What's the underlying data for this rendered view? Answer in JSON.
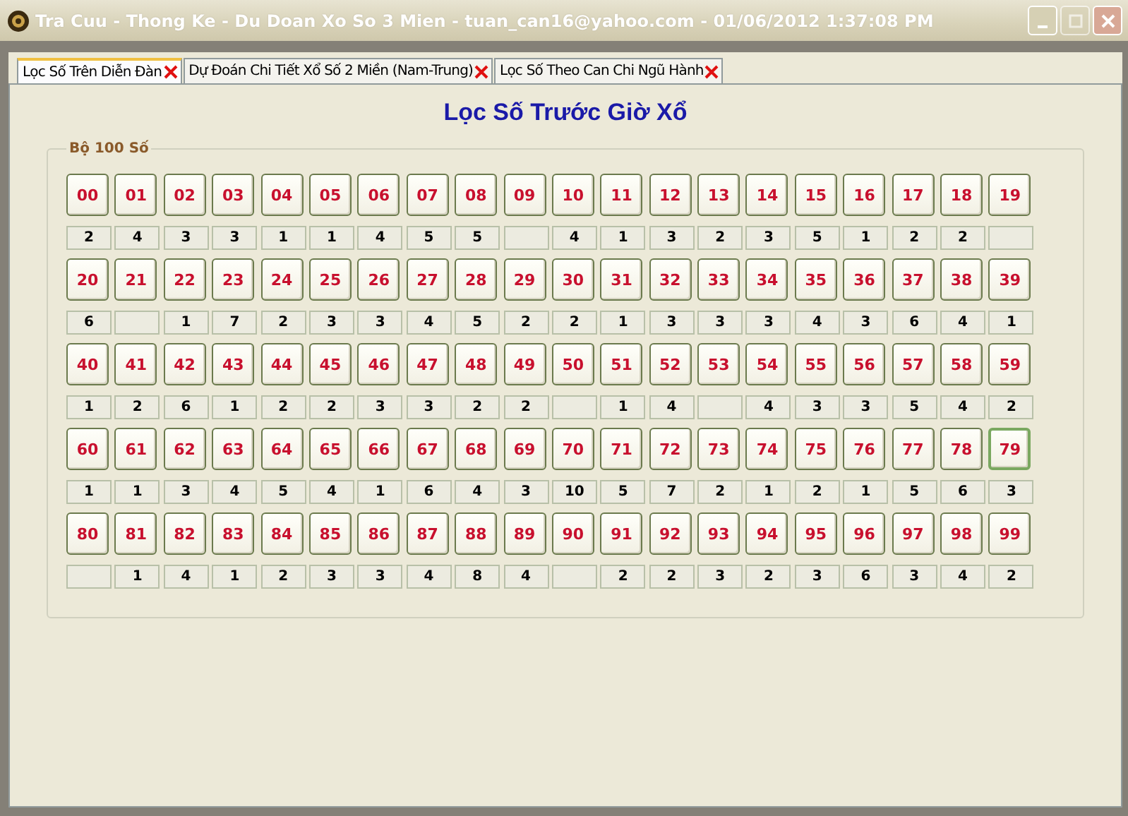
{
  "window": {
    "title": "Tra Cuu - Thong Ke - Du Doan Xo So 3 Mien - tuan_can16@yahoo.com - 01/06/2012 1:37:08 PM"
  },
  "tabs": [
    {
      "label": "Lọc Số Trên Diễn Đàn",
      "selected": true
    },
    {
      "label": "Dự Đoán Chi Tiết Xổ Số 2 Miền (Nam-Trung)",
      "selected": false
    },
    {
      "label": "Lọc Số Theo Can Chi Ngũ Hành",
      "selected": false
    }
  ],
  "heading": "Lọc Số Trước Giờ Xổ",
  "group": {
    "title": "Bộ 100 Số",
    "rows": [
      [
        {
          "number": "00",
          "count": "2",
          "focused": false
        },
        {
          "number": "01",
          "count": "4",
          "focused": false
        },
        {
          "number": "02",
          "count": "3",
          "focused": false
        },
        {
          "number": "03",
          "count": "3",
          "focused": false
        },
        {
          "number": "04",
          "count": "1",
          "focused": false
        },
        {
          "number": "05",
          "count": "1",
          "focused": false
        },
        {
          "number": "06",
          "count": "4",
          "focused": false
        },
        {
          "number": "07",
          "count": "5",
          "focused": false
        },
        {
          "number": "08",
          "count": "5",
          "focused": false
        },
        {
          "number": "09",
          "focused": false
        },
        {
          "number": "10",
          "count": "4",
          "focused": false
        },
        {
          "number": "11",
          "count": "1",
          "focused": false
        },
        {
          "number": "12",
          "count": "3",
          "focused": false
        },
        {
          "number": "13",
          "count": "2",
          "focused": false
        },
        {
          "number": "14",
          "count": "3",
          "focused": false
        },
        {
          "number": "15",
          "count": "5",
          "focused": false
        },
        {
          "number": "16",
          "count": "1",
          "focused": false
        },
        {
          "number": "17",
          "count": "2",
          "focused": false
        },
        {
          "number": "18",
          "count": "2",
          "focused": false
        },
        {
          "number": "19",
          "focused": false
        }
      ],
      [
        {
          "number": "20",
          "count": "6",
          "focused": false
        },
        {
          "number": "21",
          "focused": false
        },
        {
          "number": "22",
          "count": "1",
          "focused": false
        },
        {
          "number": "23",
          "count": "7",
          "focused": false
        },
        {
          "number": "24",
          "count": "2",
          "focused": false
        },
        {
          "number": "25",
          "count": "3",
          "focused": false
        },
        {
          "number": "26",
          "count": "3",
          "focused": false
        },
        {
          "number": "27",
          "count": "4",
          "focused": false
        },
        {
          "number": "28",
          "count": "5",
          "focused": false
        },
        {
          "number": "29",
          "count": "2",
          "focused": false
        },
        {
          "number": "30",
          "count": "2",
          "focused": false
        },
        {
          "number": "31",
          "count": "1",
          "focused": false
        },
        {
          "number": "32",
          "count": "3",
          "focused": false
        },
        {
          "number": "33",
          "count": "3",
          "focused": false
        },
        {
          "number": "34",
          "count": "3",
          "focused": false
        },
        {
          "number": "35",
          "count": "4",
          "focused": false
        },
        {
          "number": "36",
          "count": "3",
          "focused": false
        },
        {
          "number": "37",
          "count": "6",
          "focused": false
        },
        {
          "number": "38",
          "count": "4",
          "focused": false
        },
        {
          "number": "39",
          "count": "1",
          "focused": false
        }
      ],
      [
        {
          "number": "40",
          "count": "1",
          "focused": false
        },
        {
          "number": "41",
          "count": "2",
          "focused": false
        },
        {
          "number": "42",
          "count": "6",
          "focused": false
        },
        {
          "number": "43",
          "count": "1",
          "focused": false
        },
        {
          "number": "44",
          "count": "2",
          "focused": false
        },
        {
          "number": "45",
          "count": "2",
          "focused": false
        },
        {
          "number": "46",
          "count": "3",
          "focused": false
        },
        {
          "number": "47",
          "count": "3",
          "focused": false
        },
        {
          "number": "48",
          "count": "2",
          "focused": false
        },
        {
          "number": "49",
          "count": "2",
          "focused": false
        },
        {
          "number": "50",
          "focused": false
        },
        {
          "number": "51",
          "count": "1",
          "focused": false
        },
        {
          "number": "52",
          "count": "4",
          "focused": false
        },
        {
          "number": "53",
          "focused": false
        },
        {
          "number": "54",
          "count": "4",
          "focused": false
        },
        {
          "number": "55",
          "count": "3",
          "focused": false
        },
        {
          "number": "56",
          "count": "3",
          "focused": false
        },
        {
          "number": "57",
          "count": "5",
          "focused": false
        },
        {
          "number": "58",
          "count": "4",
          "focused": false
        },
        {
          "number": "59",
          "count": "2",
          "focused": false
        }
      ],
      [
        {
          "number": "60",
          "count": "1",
          "focused": false
        },
        {
          "number": "61",
          "count": "1",
          "focused": false
        },
        {
          "number": "62",
          "count": "3",
          "focused": false
        },
        {
          "number": "63",
          "count": "4",
          "focused": false
        },
        {
          "number": "64",
          "count": "5",
          "focused": false
        },
        {
          "number": "65",
          "count": "4",
          "focused": false
        },
        {
          "number": "66",
          "count": "1",
          "focused": false
        },
        {
          "number": "67",
          "count": "6",
          "focused": false
        },
        {
          "number": "68",
          "count": "4",
          "focused": false
        },
        {
          "number": "69",
          "count": "3",
          "focused": false
        },
        {
          "number": "70",
          "count": "10",
          "focused": false
        },
        {
          "number": "71",
          "count": "5",
          "focused": false
        },
        {
          "number": "72",
          "count": "7",
          "focused": false
        },
        {
          "number": "73",
          "count": "2",
          "focused": false
        },
        {
          "number": "74",
          "count": "1",
          "focused": false
        },
        {
          "number": "75",
          "count": "2",
          "focused": false
        },
        {
          "number": "76",
          "count": "1",
          "focused": false
        },
        {
          "number": "77",
          "count": "5",
          "focused": false
        },
        {
          "number": "78",
          "count": "6",
          "focused": false
        },
        {
          "number": "79",
          "count": "3",
          "focused": true
        }
      ],
      [
        {
          "number": "80",
          "focused": false
        },
        {
          "number": "81",
          "count": "1",
          "focused": false
        },
        {
          "number": "82",
          "count": "4",
          "focused": false
        },
        {
          "number": "83",
          "count": "1",
          "focused": false
        },
        {
          "number": "84",
          "count": "2",
          "focused": false
        },
        {
          "number": "85",
          "count": "3",
          "focused": false
        },
        {
          "number": "86",
          "count": "3",
          "focused": false
        },
        {
          "number": "87",
          "count": "4",
          "focused": false
        },
        {
          "number": "88",
          "count": "8",
          "focused": false
        },
        {
          "number": "89",
          "count": "4",
          "focused": false
        },
        {
          "number": "90",
          "focused": false
        },
        {
          "number": "91",
          "count": "2",
          "focused": false
        },
        {
          "number": "92",
          "count": "2",
          "focused": false
        },
        {
          "number": "93",
          "count": "3",
          "focused": false
        },
        {
          "number": "94",
          "count": "2",
          "focused": false
        },
        {
          "number": "95",
          "count": "3",
          "focused": false
        },
        {
          "number": "96",
          "count": "6",
          "focused": false
        },
        {
          "number": "97",
          "count": "3",
          "focused": false
        },
        {
          "number": "98",
          "count": "4",
          "focused": false
        },
        {
          "number": "99",
          "count": "2",
          "focused": false
        }
      ]
    ]
  }
}
